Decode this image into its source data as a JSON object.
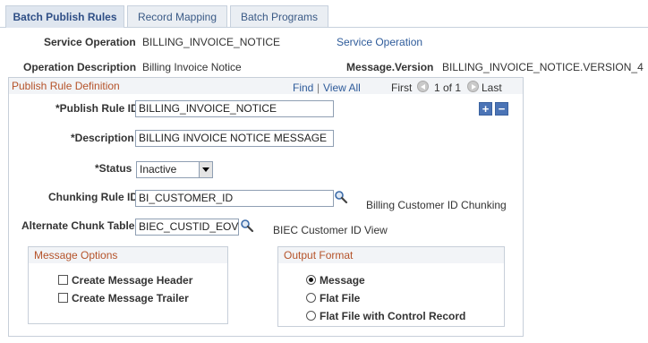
{
  "tabs": [
    "Batch Publish Rules",
    "Record Mapping",
    "Batch Programs"
  ],
  "header": {
    "service_operation_label": "Service Operation",
    "service_operation_value": "BILLING_INVOICE_NOTICE",
    "service_operation_link": "Service Operation",
    "operation_description_label": "Operation Description",
    "operation_description_value": "Billing Invoice Notice",
    "message_version_label": "Message.Version",
    "message_version_value": "BILLING_INVOICE_NOTICE.VERSION_4"
  },
  "publish_rule": {
    "section_title": "Publish Rule Definition",
    "find": "Find",
    "separator": "|",
    "view_all": "View All",
    "first": "First",
    "count": "1 of 1",
    "last": "Last",
    "publish_rule_id_label": "*Publish Rule ID",
    "publish_rule_id_value": "BILLING_INVOICE_NOTICE",
    "description_label": "*Description",
    "description_value": "BILLING INVOICE NOTICE MESSAGE",
    "status_label": "*Status",
    "status_value": "Inactive",
    "chunking_rule_id_label": "Chunking Rule ID",
    "chunking_rule_id_value": "BI_CUSTOMER_ID",
    "chunking_rule_desc": "Billing Customer ID Chunking",
    "alternate_chunk_table_label": "Alternate Chunk Table",
    "alternate_chunk_table_value": "BIEC_CUSTID_EOV",
    "alternate_chunk_table_desc": "BIEC Customer ID View",
    "add_row": "+",
    "delete_row": "−"
  },
  "message_options": {
    "title": "Message Options",
    "create_header": "Create Message Header",
    "create_trailer": "Create Message Trailer"
  },
  "output_format": {
    "title": "Output Format",
    "selected": "Message",
    "options": [
      "Message",
      "Flat File",
      "Flat File with Control Record"
    ]
  }
}
